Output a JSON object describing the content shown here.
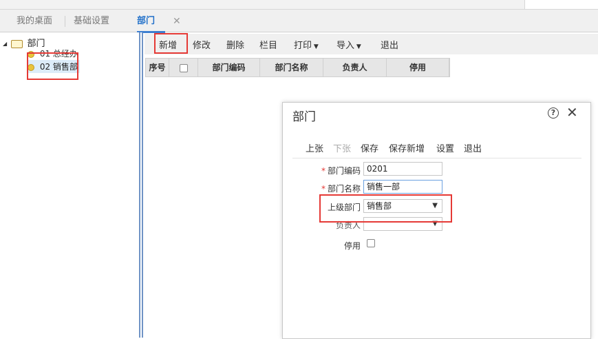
{
  "tabs": {
    "desktop": "我的桌面",
    "basic": "基础设置",
    "active": "部门",
    "close": "✕"
  },
  "tree": {
    "root": "部门",
    "items": [
      {
        "label": "01 总经办"
      },
      {
        "label": "02 销售部"
      }
    ]
  },
  "toolbar": {
    "add": "新增",
    "edit": "修改",
    "delete": "删除",
    "columns": "栏目",
    "print": "打印",
    "import": "导入",
    "exit": "退出"
  },
  "grid": {
    "headers": [
      "序号",
      "部门编码",
      "部门名称",
      "负责人",
      "停用"
    ]
  },
  "dialog": {
    "title": "部门",
    "help": "?",
    "close": "✕",
    "toolbar": {
      "prev": "上张",
      "next": "下张",
      "save": "保存",
      "save_new": "保存新增",
      "settings": "设置",
      "exit": "退出"
    },
    "fields": {
      "code_label": "部门编码",
      "code_value": "0201",
      "name_label": "部门名称",
      "name_value": "销售一部",
      "parent_label": "上级部门",
      "parent_value": "销售部",
      "manager_label": "负责人",
      "manager_value": "",
      "disabled_label": "停用"
    }
  },
  "colors": {
    "accent": "#3d7fd1",
    "highlight_box": "#e53935"
  }
}
